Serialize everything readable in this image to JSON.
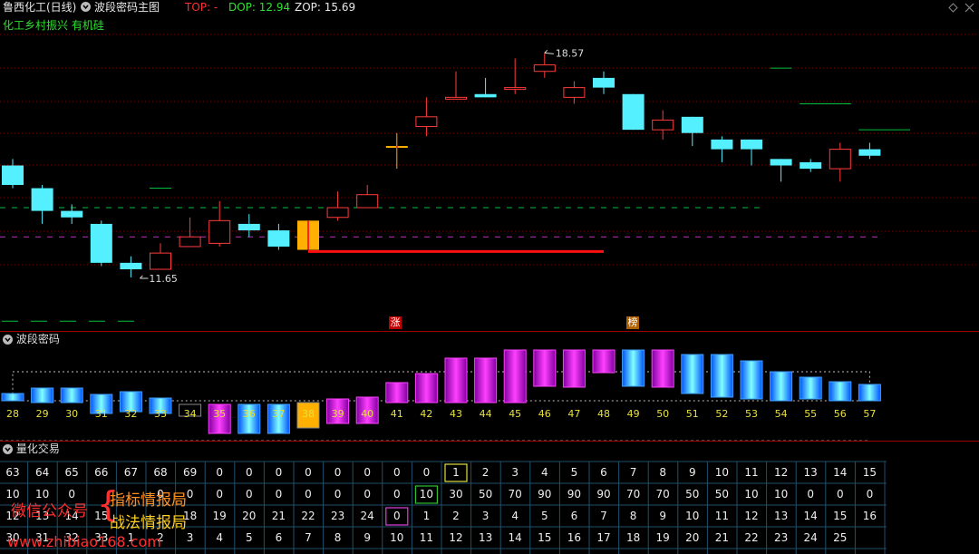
{
  "header": {
    "stock_name": "鲁西化工",
    "period": "(日线)",
    "indicator": "波段密码主图",
    "top_label": "TOP: -",
    "dop_label": "DOP: 12.94",
    "zop_label": "ZOP: 15.69",
    "concept_tags": "化工乡村振兴 有机硅"
  },
  "colors": {
    "bull": "#ff3b3b",
    "bear": "#54f0ff",
    "signal": "#ffb000",
    "magenta": "#ff00ff",
    "green": "#00c040",
    "grid_red": "#7a0000"
  },
  "main_chart": {
    "high_label": "18.57",
    "low_label": "11.65",
    "marker_zhang": "涨",
    "marker_bang": "榜"
  },
  "chart_data": {
    "type": "candlestick",
    "title": "鲁西化工 (日线)",
    "y_range": [
      10.0,
      20.2
    ],
    "candles": [
      {
        "o": 15.1,
        "c": 14.5,
        "h": 15.3,
        "l": 14.4
      },
      {
        "o": 14.4,
        "c": 13.7,
        "h": 14.5,
        "l": 13.3
      },
      {
        "o": 13.7,
        "c": 13.5,
        "h": 13.9,
        "l": 13.3
      },
      {
        "o": 13.3,
        "c": 12.1,
        "h": 13.4,
        "l": 12.0
      },
      {
        "o": 12.1,
        "c": 11.9,
        "h": 12.3,
        "l": 11.65
      },
      {
        "o": 11.9,
        "c": 12.4,
        "h": 12.7,
        "l": 11.9
      },
      {
        "o": 12.6,
        "c": 12.9,
        "h": 13.5,
        "l": 12.6
      },
      {
        "o": 12.7,
        "c": 13.4,
        "h": 14.0,
        "l": 12.6
      },
      {
        "o": 13.3,
        "c": 13.1,
        "h": 13.6,
        "l": 12.9
      },
      {
        "o": 13.1,
        "c": 12.6,
        "h": 13.3,
        "l": 12.5
      },
      {
        "o": 12.5,
        "c": 13.4,
        "h": 13.4,
        "l": 12.5
      },
      {
        "o": 13.5,
        "c": 13.8,
        "h": 14.3,
        "l": 13.4
      },
      {
        "o": 13.8,
        "c": 14.2,
        "h": 14.5,
        "l": 13.8
      },
      {
        "o": 15.7,
        "c": 15.7,
        "h": 16.1,
        "l": 15.0
      },
      {
        "o": 16.3,
        "c": 16.6,
        "h": 17.2,
        "l": 16.0
      },
      {
        "o": 17.2,
        "c": 17.2,
        "h": 18.0,
        "l": 17.2
      },
      {
        "o": 17.3,
        "c": 17.2,
        "h": 17.8,
        "l": 17.2
      },
      {
        "o": 17.5,
        "c": 17.5,
        "h": 18.4,
        "l": 17.3
      },
      {
        "o": 18.0,
        "c": 18.2,
        "h": 18.57,
        "l": 17.8
      },
      {
        "o": 17.2,
        "c": 17.5,
        "h": 17.7,
        "l": 17.0
      },
      {
        "o": 17.8,
        "c": 17.5,
        "h": 18.0,
        "l": 17.3
      },
      {
        "o": 17.3,
        "c": 16.2,
        "h": 17.3,
        "l": 16.2
      },
      {
        "o": 16.2,
        "c": 16.5,
        "h": 16.8,
        "l": 15.9
      },
      {
        "o": 16.6,
        "c": 16.1,
        "h": 16.6,
        "l": 15.7
      },
      {
        "o": 15.9,
        "c": 15.6,
        "h": 16.0,
        "l": 15.2
      },
      {
        "o": 15.9,
        "c": 15.6,
        "h": 15.9,
        "l": 15.1
      },
      {
        "o": 15.3,
        "c": 15.1,
        "h": 15.3,
        "l": 14.6
      },
      {
        "o": 15.2,
        "c": 15.0,
        "h": 15.3,
        "l": 14.9
      },
      {
        "o": 15.0,
        "c": 15.6,
        "h": 15.8,
        "l": 14.6
      },
      {
        "o": 15.6,
        "c": 15.4,
        "h": 15.8,
        "l": 15.3
      }
    ],
    "signal_candles": [
      10,
      13
    ],
    "green_level": 13.8,
    "magenta_level": 12.9,
    "red_support": {
      "value": 12.45,
      "from": 10,
      "to": 20
    },
    "upper_levels": [
      {
        "from": 26,
        "to": 26,
        "value": 18.1
      },
      {
        "from": 27,
        "to": 28,
        "value": 17.0
      },
      {
        "from": 29,
        "to": 30,
        "value": 16.2
      },
      {
        "from": 5,
        "to": 5,
        "value": 14.4
      },
      {
        "from": 0,
        "to": 4,
        "value": 10.3
      }
    ]
  },
  "sub_panel_1": {
    "title": "波段密码",
    "x_labels": [
      "28",
      "29",
      "30",
      "31",
      "32",
      "33",
      "34",
      "35",
      "36",
      "37",
      "38",
      "39",
      "40",
      "41",
      "42",
      "43",
      "44",
      "45",
      "46",
      "47",
      "48",
      "49",
      "50",
      "51",
      "52",
      "53",
      "54",
      "55",
      "56",
      "57"
    ]
  },
  "sub_panel_2": {
    "title": "量化交易",
    "rows": [
      [
        "63",
        "64",
        "65",
        "66",
        "67",
        "68",
        "69",
        "0",
        "0",
        "0",
        "0",
        "0",
        "0",
        "0",
        "0",
        "1",
        "2",
        "3",
        "4",
        "5",
        "6",
        "7",
        "8",
        "9",
        "10",
        "11",
        "12",
        "13",
        "14",
        "15"
      ],
      [
        "10",
        "10",
        "0",
        "",
        "",
        "0",
        "0",
        "0",
        "0",
        "0",
        "0",
        "0",
        "0",
        "0",
        "10",
        "30",
        "50",
        "70",
        "90",
        "90",
        "90",
        "70",
        "70",
        "50",
        "50",
        "10",
        "10",
        "0",
        "0",
        "0"
      ],
      [
        "12",
        "13",
        "14",
        "15",
        "",
        "",
        "18",
        "19",
        "20",
        "21",
        "22",
        "23",
        "24",
        "0",
        "1",
        "2",
        "3",
        "4",
        "5",
        "6",
        "7",
        "8",
        "9",
        "10",
        "11",
        "12",
        "13",
        "14",
        "15",
        "16"
      ],
      [
        "30",
        "31",
        "32",
        "33",
        "1",
        "2",
        "3",
        "4",
        "5",
        "6",
        "7",
        "8",
        "9",
        "10",
        "11",
        "12",
        "13",
        "14",
        "15",
        "16",
        "17",
        "18",
        "19",
        "20",
        "21",
        "22",
        "23",
        "24",
        "25",
        ""
      ]
    ],
    "highlight_cells": [
      {
        "row": 0,
        "col": 15,
        "color": "#e0e040"
      },
      {
        "row": 1,
        "col": 14,
        "color": "#30c030"
      },
      {
        "row": 2,
        "col": 13,
        "color": "#e040e0"
      }
    ]
  },
  "watermarks": {
    "wechat": "微信公众号",
    "brace": "{",
    "line1": "指标情报局",
    "line2": "战法情报局",
    "url": "www.zhibiao168.com"
  }
}
